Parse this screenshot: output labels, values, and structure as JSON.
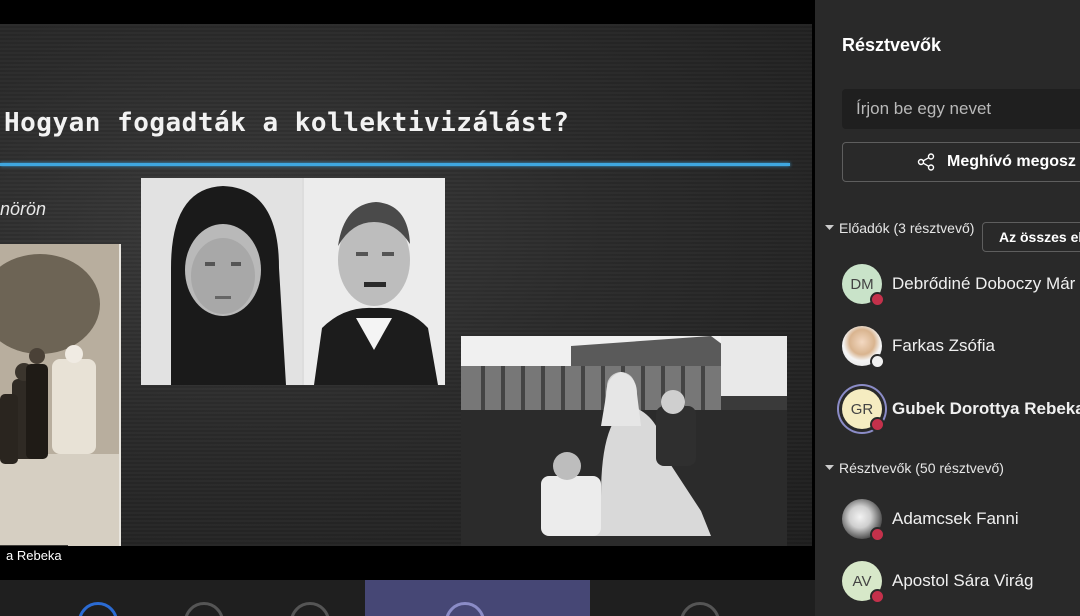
{
  "slide": {
    "title": "Hogyan fogadták a kollektivizálást?",
    "subtitle": "nörön",
    "speaker_tag": "a Rebeka"
  },
  "panel": {
    "title": "Résztvevők",
    "search_placeholder": "Írjon be egy nevet",
    "invite_label": "Meghívó megosz",
    "presenters_heading": "Előadók (3 résztvevő)",
    "mute_all_label": "Az összes el",
    "attendees_heading": "Résztvevők (50 résztvevő)",
    "presenters": [
      {
        "initials": "DM",
        "name": "Debrődiné Doboczy Már",
        "avatar_bg": "#c9e3c9",
        "status": "muted-red"
      },
      {
        "initials": "",
        "name": "Farkas Zsófia",
        "avatar_bg": "photo",
        "status": "muted-white"
      },
      {
        "initials": "GR",
        "name": "Gubek Dorottya Rebeka",
        "avatar_bg": "#f5ecc1",
        "status": "muted-red",
        "speaking": true
      }
    ],
    "attendees": [
      {
        "initials": "",
        "name": "Adamcsek Fanni",
        "avatar_bg": "photo",
        "status": "muted-red"
      },
      {
        "initials": "AV",
        "name": "Apostol Sára Virág",
        "avatar_bg": "#d7e8c9",
        "status": "muted-red"
      }
    ]
  },
  "colors": {
    "panel_bg": "#292929",
    "accent_blue": "#3fa7e0",
    "status_red": "#c4314b",
    "speaking_ring": "#8b8cc7",
    "active_call_button": "#464775"
  },
  "icons": {
    "invite": "share-icon",
    "section_toggle": "chevron-down-icon",
    "mic_status": "microphone-off-icon"
  }
}
